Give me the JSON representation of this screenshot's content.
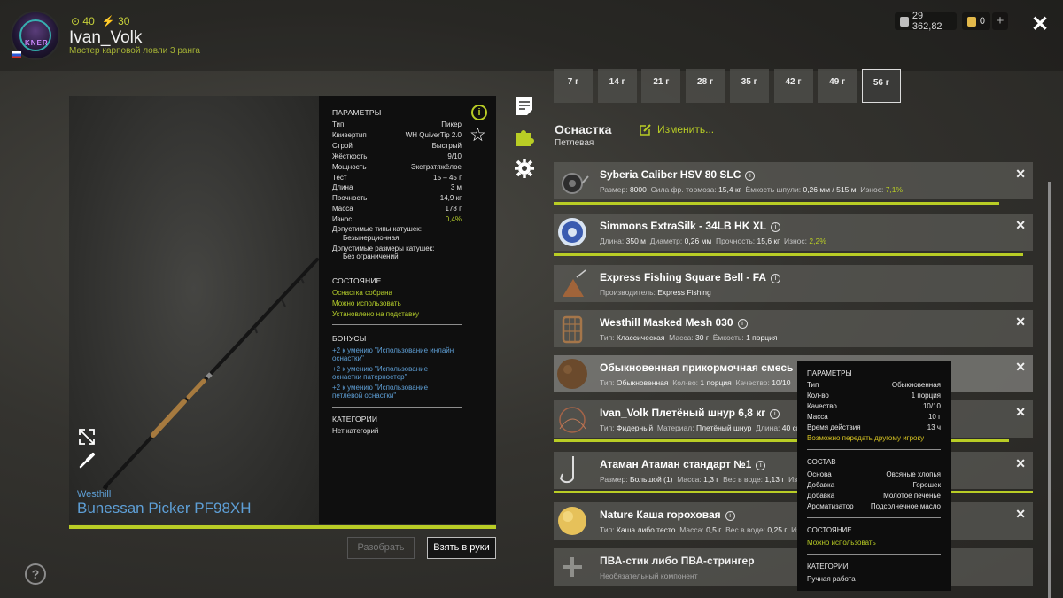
{
  "player": {
    "name": "Ivan_Volk",
    "rank": "Мастер карповой ловли 3 ранга",
    "coins": "40",
    "energy": "30",
    "avatar_text": "KNER"
  },
  "wallet": {
    "silver": "29 362,82",
    "gold": "0"
  },
  "rod": {
    "brand": "Westhill",
    "name": "Bunessan Picker PF98XH",
    "params_header": "ПАРАМЕТРЫ",
    "params": [
      {
        "label": "Тип",
        "value": "Пикер"
      },
      {
        "label": "Квивертип",
        "value": "WH QuiverTip 2.0"
      },
      {
        "label": "Строй",
        "value": "Быстрый"
      },
      {
        "label": "Жёсткость",
        "value": "9/10"
      },
      {
        "label": "Мощность",
        "value": "Экстратяжёлое"
      },
      {
        "label": "Тест",
        "value": "15 – 45 г"
      },
      {
        "label": "Длина",
        "value": "3 м"
      },
      {
        "label": "Прочность",
        "value": "14,9 кг"
      },
      {
        "label": "Масса",
        "value": "178 г"
      },
      {
        "label": "Износ",
        "value": "0,4%"
      }
    ],
    "reel_types_label": "Допустимые типы катушек:",
    "reel_types_value": "Безынерционная",
    "reel_sizes_label": "Допустимые размеры катушек:",
    "reel_sizes_value": "Без ограничений",
    "state_header": "СОСТОЯНИЕ",
    "state": [
      "Оснастка собрана",
      "Можно использовать",
      "Установлено на подставку"
    ],
    "bonus_header": "БОНУСЫ",
    "bonuses": [
      [
        "+2 к умению \"Использование инлайн",
        "оснастки\""
      ],
      [
        "+2 к умению \"Использование",
        "оснастки патерностер\""
      ],
      [
        "+2 к умению \"Использование",
        "петлевой оснастки\""
      ]
    ],
    "cat_header": "КАТЕГОРИИ",
    "category": "Нет категорий",
    "wear_percent": 100
  },
  "buttons": {
    "disassemble": "Разобрать",
    "take": "Взять в руки"
  },
  "weights": [
    "7 г",
    "14 г",
    "21 г",
    "28 г",
    "35 г",
    "42 г",
    "49 г",
    "56 г"
  ],
  "active_weight": "56 г",
  "rig": {
    "title": "Оснастка",
    "subtitle": "Петлевая",
    "edit": "Изменить..."
  },
  "items": [
    {
      "title": "Syberia Caliber HSV 80 SLC",
      "meta": [
        [
          "Размер:",
          "8000"
        ],
        [
          "Сила фр. тормоза:",
          "15,4 кг"
        ],
        [
          "Ёмкость шпули:",
          "0,26 мм / 515 м"
        ],
        [
          "Износ:",
          "7,1%"
        ]
      ],
      "bar": 0.93,
      "removable": true,
      "thumb": "reel"
    },
    {
      "title": "Simmons ExtraSilk - 34LB HK XL",
      "meta": [
        [
          "Длина:",
          "350 м"
        ],
        [
          "Диаметр:",
          "0,26 мм"
        ],
        [
          "Прочность:",
          "15,6 кг"
        ],
        [
          "Износ:",
          "2,2%"
        ]
      ],
      "bar": 0.98,
      "removable": true,
      "thumb": "line"
    },
    {
      "title": "Express Fishing Square Bell - FA",
      "meta": [
        [
          "Производитель:",
          "Express Fishing"
        ]
      ],
      "bar": 0,
      "removable": false,
      "thumb": "bell"
    },
    {
      "title": "Westhill Masked Mesh 030",
      "meta": [
        [
          "Тип:",
          "Классическая"
        ],
        [
          "Масса:",
          "30 г"
        ],
        [
          "Ёмкость:",
          "1 порция"
        ]
      ],
      "bar": 0,
      "removable": true,
      "thumb": "feeder"
    },
    {
      "title": "Обыкновенная прикормочная смесь",
      "meta": [
        [
          "Тип:",
          "Обыкновенная"
        ],
        [
          "Кол-во:",
          "1 порция"
        ],
        [
          "Качество:",
          "10/10"
        ]
      ],
      "bar": 0,
      "removable": true,
      "thumb": "ball"
    },
    {
      "title": "Ivan_Volk Плетёный шнур 6,8 кг",
      "meta": [
        [
          "Тип:",
          "Фидерный"
        ],
        [
          "Материал:",
          "Плетёный шнур"
        ],
        [
          "Длина:",
          "40 см"
        ]
      ],
      "bar": 0.95,
      "removable": true,
      "thumb": "cord"
    },
    {
      "title": "Атаман Атаман стандарт №1",
      "meta": [
        [
          "Размер:",
          "Большой (1)"
        ],
        [
          "Масса:",
          "1,3 г"
        ],
        [
          "Вес в воде:",
          "1,13 г"
        ],
        [
          "Износ:",
          ""
        ]
      ],
      "bar": 1.0,
      "removable": true,
      "thumb": "hook"
    },
    {
      "title": "Nature Каша гороховая",
      "meta": [
        [
          "Тип:",
          "Каша либо тесто"
        ],
        [
          "Масса:",
          "0,5 г"
        ],
        [
          "Вес в воде:",
          "0,25 г"
        ],
        [
          "Износ:",
          ""
        ]
      ],
      "bar": 0,
      "removable": true,
      "thumb": "bait"
    },
    {
      "title": "ПВА-стик либо ПВА-стрингер",
      "meta": [
        [
          "Необязательный компонент",
          ""
        ]
      ],
      "bar": 0,
      "removable": false,
      "thumb": "plus"
    }
  ],
  "tooltip": {
    "params_header": "ПАРАМЕТРЫ",
    "params": [
      {
        "label": "Тип",
        "value": "Обыкновенная"
      },
      {
        "label": "Кол-во",
        "value": "1 порция"
      },
      {
        "label": "Качество",
        "value": "10/10"
      },
      {
        "label": "Масса",
        "value": "10 г"
      },
      {
        "label": "Время действия",
        "value": "13 ч"
      }
    ],
    "transfer": "Возможно передать другому игроку",
    "comp_header": "СОСТАВ",
    "composition": [
      {
        "label": "Основа",
        "value": "Овсяные хлопья"
      },
      {
        "label": "Добавка",
        "value": "Горошек"
      },
      {
        "label": "Добавка",
        "value": "Молотое печенье"
      },
      {
        "label": "Ароматизатор",
        "value": "Подсолнечное масло"
      }
    ],
    "state_header": "СОСТОЯНИЕ",
    "state": "Можно использовать",
    "cat_header": "КАТЕГОРИИ",
    "category": "Ручная работа"
  },
  "colors": {
    "accent": "#b9cd25",
    "link": "#5e9fd6"
  }
}
